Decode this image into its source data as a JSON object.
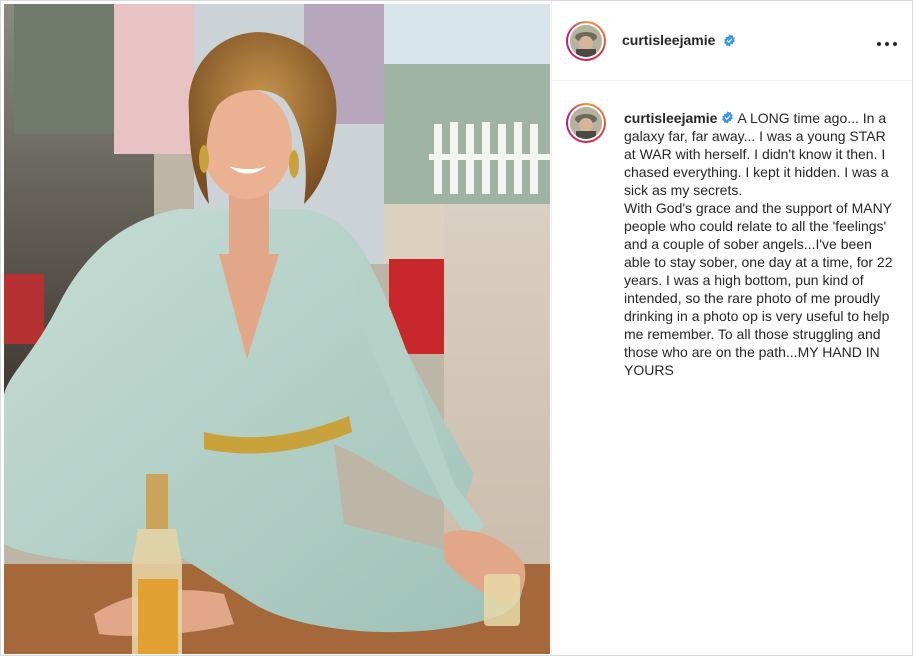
{
  "post": {
    "username": "curtisleejamie",
    "verified": true,
    "more_icon": "more-horizontal-icon",
    "verified_icon": "verified-badge-icon",
    "caption_username": "curtisleejamie",
    "caption_text": "A LONG time ago... In a galaxy far, far away... I was a young STAR at WAR with herself. I didn't know it then. I chased everything. I kept it hidden. I was a sick as my secrets.\nWith God's grace and the support of MANY people who could relate to all the 'feelings' and a couple of sober angels...I've been able to stay sober, one day at a time, for 22 years. I was a high bottom, pun kind of intended, so the rare photo of me proudly drinking in a photo op is very useful to help me remember. To all those struggling and those who are on the path...MY HAND IN YOURS"
  },
  "colors": {
    "verified_blue": "#3897f0",
    "text": "#262626",
    "border": "#dbdbdb"
  }
}
